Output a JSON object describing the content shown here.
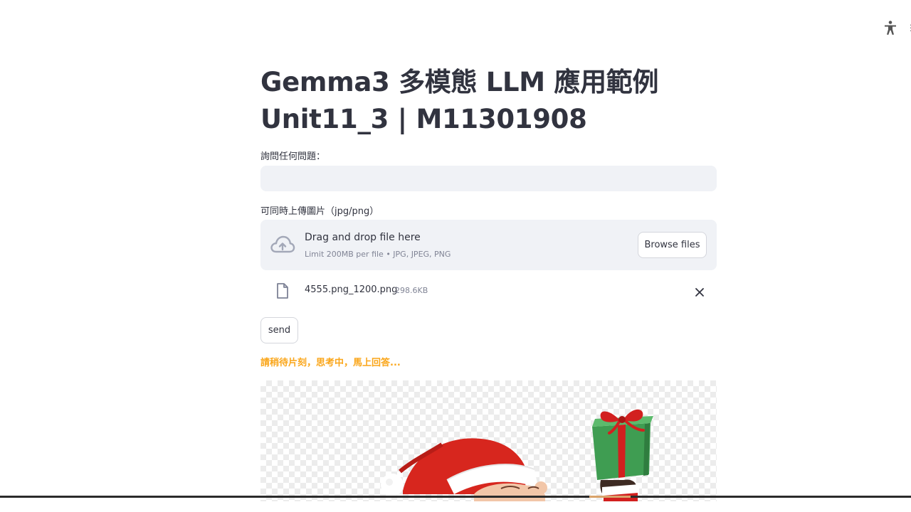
{
  "header": {
    "title_line1": "Gemma3 多模態 LLM 應用範例",
    "title_line2": "Unit11_3 | M11301908"
  },
  "question": {
    "label": "詢問任何問題：",
    "value": "",
    "placeholder": ""
  },
  "upload": {
    "label": "可同時上傳圖片（jpg/png）",
    "drop_title": "Drag and drop file here",
    "drop_subtitle": "Limit 200MB per file • JPG, JPEG, PNG",
    "browse_label": "Browse files",
    "file": {
      "name": "4555.png_1200.png",
      "size": "298.6KB"
    }
  },
  "send_label": "send",
  "status_text": "請稍待片刻，思考中，馬上回答...",
  "colors": {
    "status": "#faa61a",
    "input_bg": "#f0f2f6",
    "text": "#31333f",
    "muted": "#808495"
  },
  "icons": {
    "accessibility": "accessibility-icon",
    "upload": "cloud-upload-icon",
    "file": "file-icon",
    "remove": "close-icon"
  }
}
